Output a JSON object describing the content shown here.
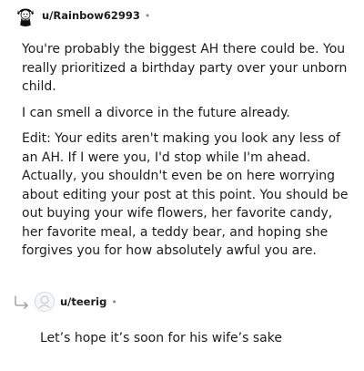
{
  "comment": {
    "username": "u/Rainbow62993",
    "separator": "•",
    "paragraphs": [
      "You're probably the biggest AH there could be. You really prioritized a birthday party over your unborn child.",
      "I can smell a divorce in the future already.",
      "Edit: Your edits aren't making you look any less of an AH. If I were you, I'd stop while I'm ahead. Actually, you shouldn't even be on here worrying about editing your post at this point. You should be out buying your wife flowers, her favorite candy, her favorite meal, a teddy bear, and hoping she forgives you for how absolutely awful you are."
    ]
  },
  "reply": {
    "username": "u/teerig",
    "separator": "•",
    "text": "Let’s hope it’s soon for his wife’s sake"
  },
  "icons": {
    "commenter_avatar": "avatar-icon",
    "reply_arrow": "reply-arrow-icon",
    "reply_avatar": "default-avatar-icon"
  },
  "colors": {
    "text": "#1c1c1c",
    "meta": "#878a8c"
  }
}
